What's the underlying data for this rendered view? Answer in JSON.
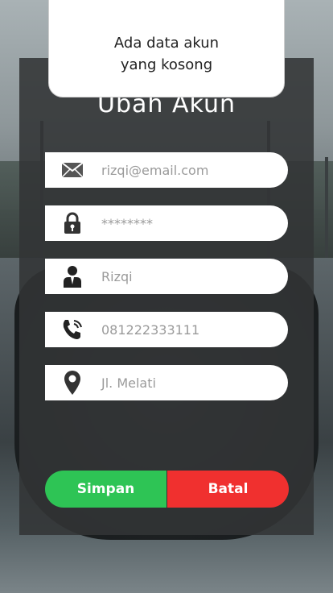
{
  "toast": {
    "line1": "Ada data akun",
    "line2": "yang kosong"
  },
  "page": {
    "title": "Ubah Akun"
  },
  "fields": [
    {
      "icon": "mail-icon",
      "value": "rizqi@email.com"
    },
    {
      "icon": "lock-icon",
      "value": "********"
    },
    {
      "icon": "user-icon",
      "value": "Rizqi"
    },
    {
      "icon": "phone-icon",
      "value": "081222333111"
    },
    {
      "icon": "location-pin-icon",
      "value": "Jl. Melati"
    }
  ],
  "buttons": {
    "save": "Simpan",
    "cancel": "Batal"
  },
  "colors": {
    "save": "#2ec455",
    "cancel": "#f0302f",
    "panel": "#323436"
  }
}
